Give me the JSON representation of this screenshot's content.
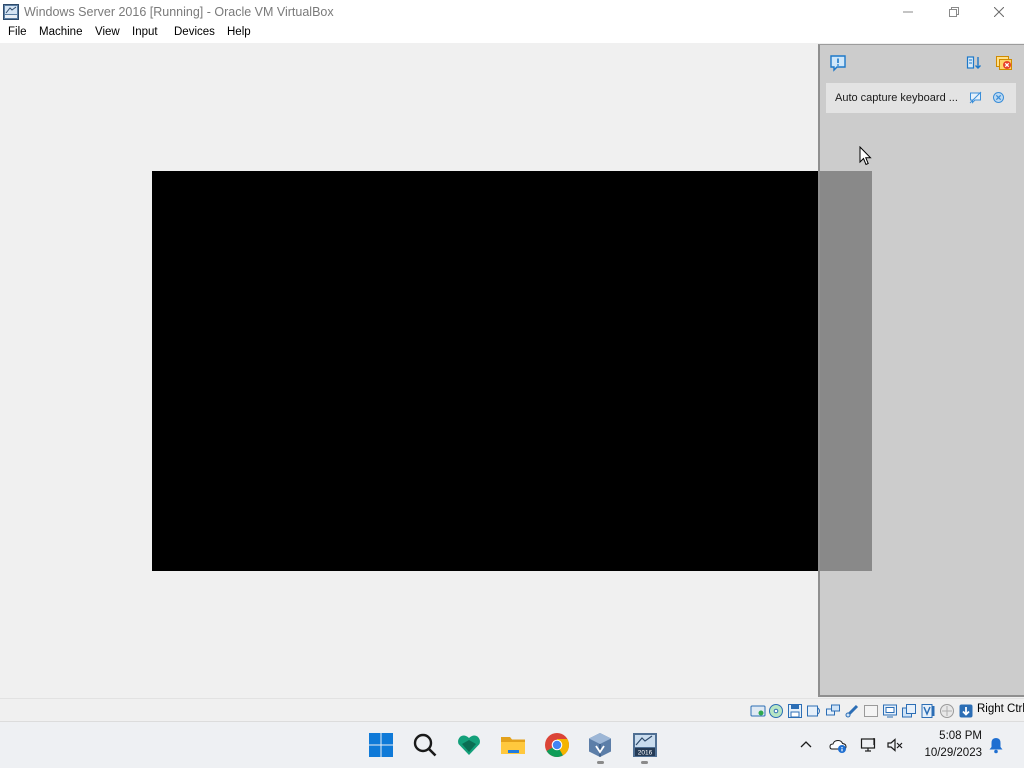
{
  "window": {
    "title": "Windows Server 2016 [Running] - Oracle VM VirtualBox",
    "icon": "virtualbox-vm-icon",
    "controls": {
      "minimize": "minimize-icon",
      "maximize": "restore-icon",
      "close": "close-icon"
    }
  },
  "menu": {
    "items": [
      {
        "label": "File"
      },
      {
        "label": "Machine"
      },
      {
        "label": "View"
      },
      {
        "label": "Input"
      },
      {
        "label": "Devices"
      },
      {
        "label": "Help"
      }
    ]
  },
  "notification_panel": {
    "header_icons": [
      "info-icon",
      "toggle-panel-icon",
      "close-all-icon"
    ],
    "items": [
      {
        "text": "Auto capture keyboard ...",
        "dont_show_icon": "dont-show-again-icon",
        "close_icon": "close-notification-icon"
      }
    ]
  },
  "statusbar": {
    "icons": [
      "hard-disk-icon",
      "optical-drive-icon",
      "floppy-icon",
      "audio-icon",
      "network-icon",
      "usb-icon",
      "shared-folders-icon",
      "display-icon",
      "video-capture-icon",
      "vt-x-icon",
      "mouse-integration-icon",
      "keyboard-capture-icon"
    ],
    "host_key": "Right Ctrl"
  },
  "taskbar": {
    "apps": [
      "start-icon",
      "search-icon",
      "copilot-icon",
      "file-explorer-icon",
      "chrome-icon",
      "virtualbox-manager-icon",
      "windows-server-2016-vm-icon"
    ],
    "tray": [
      "show-hidden-icons-chevron",
      "onedrive-icon",
      "network-icon",
      "volume-muted-icon"
    ],
    "time": "5:08 PM",
    "date": "10/29/2023",
    "notification_icon": "notification-bell-icon"
  },
  "colors": {
    "vm_screen": "#000000",
    "window_bg": "#f0f0f0",
    "accent_blue": "#0067c0"
  }
}
